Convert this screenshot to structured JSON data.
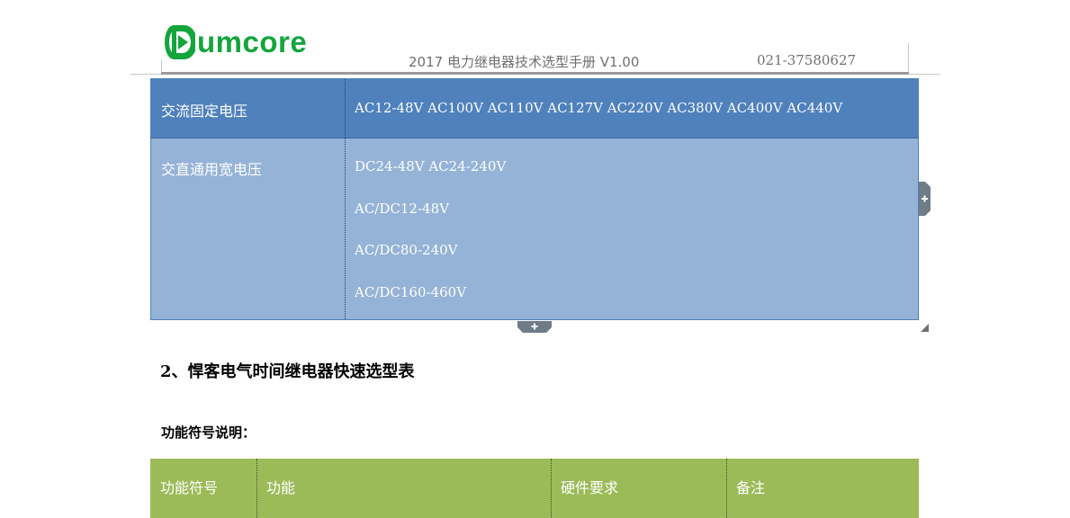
{
  "header": {
    "logo_text": "umcore",
    "doc_title": "2017 电力继电器技术选型手册 V1.00",
    "phone": "021-37580627",
    "brand_color": "#14a53c"
  },
  "voltage_table": {
    "row1": {
      "label": "交流固定电压",
      "value": "AC12-48V AC100V AC110V AC127V AC220V AC380V AC400V AC440V"
    },
    "row2": {
      "label": "交直通用宽电压",
      "values": [
        "DC24-48V AC24-240V",
        "AC/DC12-48V",
        "AC/DC80-240V",
        "AC/DC160-460V"
      ]
    },
    "colors": {
      "header_bg": "#4f81bd",
      "body_bg": "#95b3d7"
    }
  },
  "section_title": "2、悍客电气时间继电器快速选型表",
  "subtitle": "功能符号说明：",
  "function_table": {
    "headers": [
      "功能符号",
      "功能",
      "硬件要求",
      "备注"
    ],
    "color": "#9bbb59"
  },
  "icons": {
    "add_column": "plus-icon",
    "add_row": "plus-icon",
    "resize": "resize-handle-icon"
  }
}
